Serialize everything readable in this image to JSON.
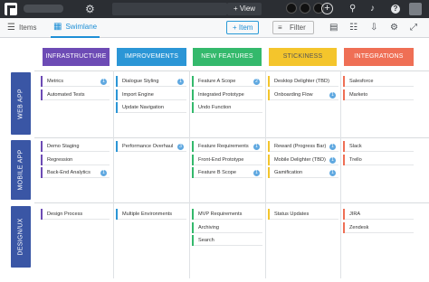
{
  "topbar": {
    "view_label": "+ View",
    "help_symbol": "?"
  },
  "toolbar": {
    "tabs": [
      {
        "label": "Items",
        "active": false
      },
      {
        "label": "Swimlane",
        "active": true
      }
    ],
    "add_item_label": "+ Item",
    "filter_label": "Filter"
  },
  "columns": [
    {
      "label": "INFRASTRUCTURE",
      "color": "#6d4bb5"
    },
    {
      "label": "IMPROVEMENTS",
      "color": "#2b96d6"
    },
    {
      "label": "NEW FEATURES",
      "color": "#34b96c"
    },
    {
      "label": "STICKINESS",
      "color": "#f4c52c"
    },
    {
      "label": "INTEGRATIONS",
      "color": "#ef6f55"
    }
  ],
  "rows": [
    {
      "label": "WEB APP"
    },
    {
      "label": "MOBILE APP"
    },
    {
      "label": "DESIGN/UX"
    }
  ],
  "cards": {
    "r0": {
      "c0": [
        {
          "text": "Metrics",
          "badge": "1"
        },
        {
          "text": "Automated Tests",
          "badge": ""
        }
      ],
      "c1": [
        {
          "text": "Dialogue Styling",
          "badge": "1"
        },
        {
          "text": "Import Engine",
          "badge": ""
        },
        {
          "text": "Update Navigation",
          "badge": ""
        }
      ],
      "c2": [
        {
          "text": "Feature A Scope",
          "badge": "2"
        },
        {
          "text": "Integrated Prototype",
          "badge": ""
        },
        {
          "text": "Undo Function",
          "badge": ""
        }
      ],
      "c3": [
        {
          "text": "Desktop Delighter (TBD)",
          "badge": ""
        },
        {
          "text": "Onboarding Flow",
          "badge": "1"
        }
      ],
      "c4": [
        {
          "text": "Salesforce",
          "badge": ""
        },
        {
          "text": "Marketo",
          "badge": ""
        }
      ]
    },
    "r1": {
      "c0": [
        {
          "text": "Demo Staging",
          "badge": ""
        },
        {
          "text": "Regression",
          "badge": ""
        },
        {
          "text": "Back-End Analytics",
          "badge": "1"
        }
      ],
      "c1": [
        {
          "text": "Performance Overhaul",
          "badge": "3"
        }
      ],
      "c2": [
        {
          "text": "Feature Requirements",
          "badge": "1"
        },
        {
          "text": "Front-End Prototype",
          "badge": ""
        },
        {
          "text": "Feature B Scope",
          "badge": "1"
        }
      ],
      "c3": [
        {
          "text": "Reward (Progress Bar)",
          "badge": "1"
        },
        {
          "text": "Mobile Delighter (TBD)",
          "badge": "1"
        },
        {
          "text": "Gamification",
          "badge": "1"
        }
      ],
      "c4": [
        {
          "text": "Slack",
          "badge": ""
        },
        {
          "text": "Trello",
          "badge": ""
        }
      ]
    },
    "r2": {
      "c0": [
        {
          "text": "Design Process",
          "badge": ""
        }
      ],
      "c1": [
        {
          "text": "Multiple Environments",
          "badge": ""
        }
      ],
      "c2": [
        {
          "text": "MVP Requirements",
          "badge": ""
        },
        {
          "text": "Archiving",
          "badge": ""
        },
        {
          "text": "Search",
          "badge": ""
        }
      ],
      "c3": [
        {
          "text": "Status Updates",
          "badge": ""
        }
      ],
      "c4": [
        {
          "text": "JIRA",
          "badge": ""
        },
        {
          "text": "Zendesk",
          "badge": ""
        }
      ]
    }
  }
}
